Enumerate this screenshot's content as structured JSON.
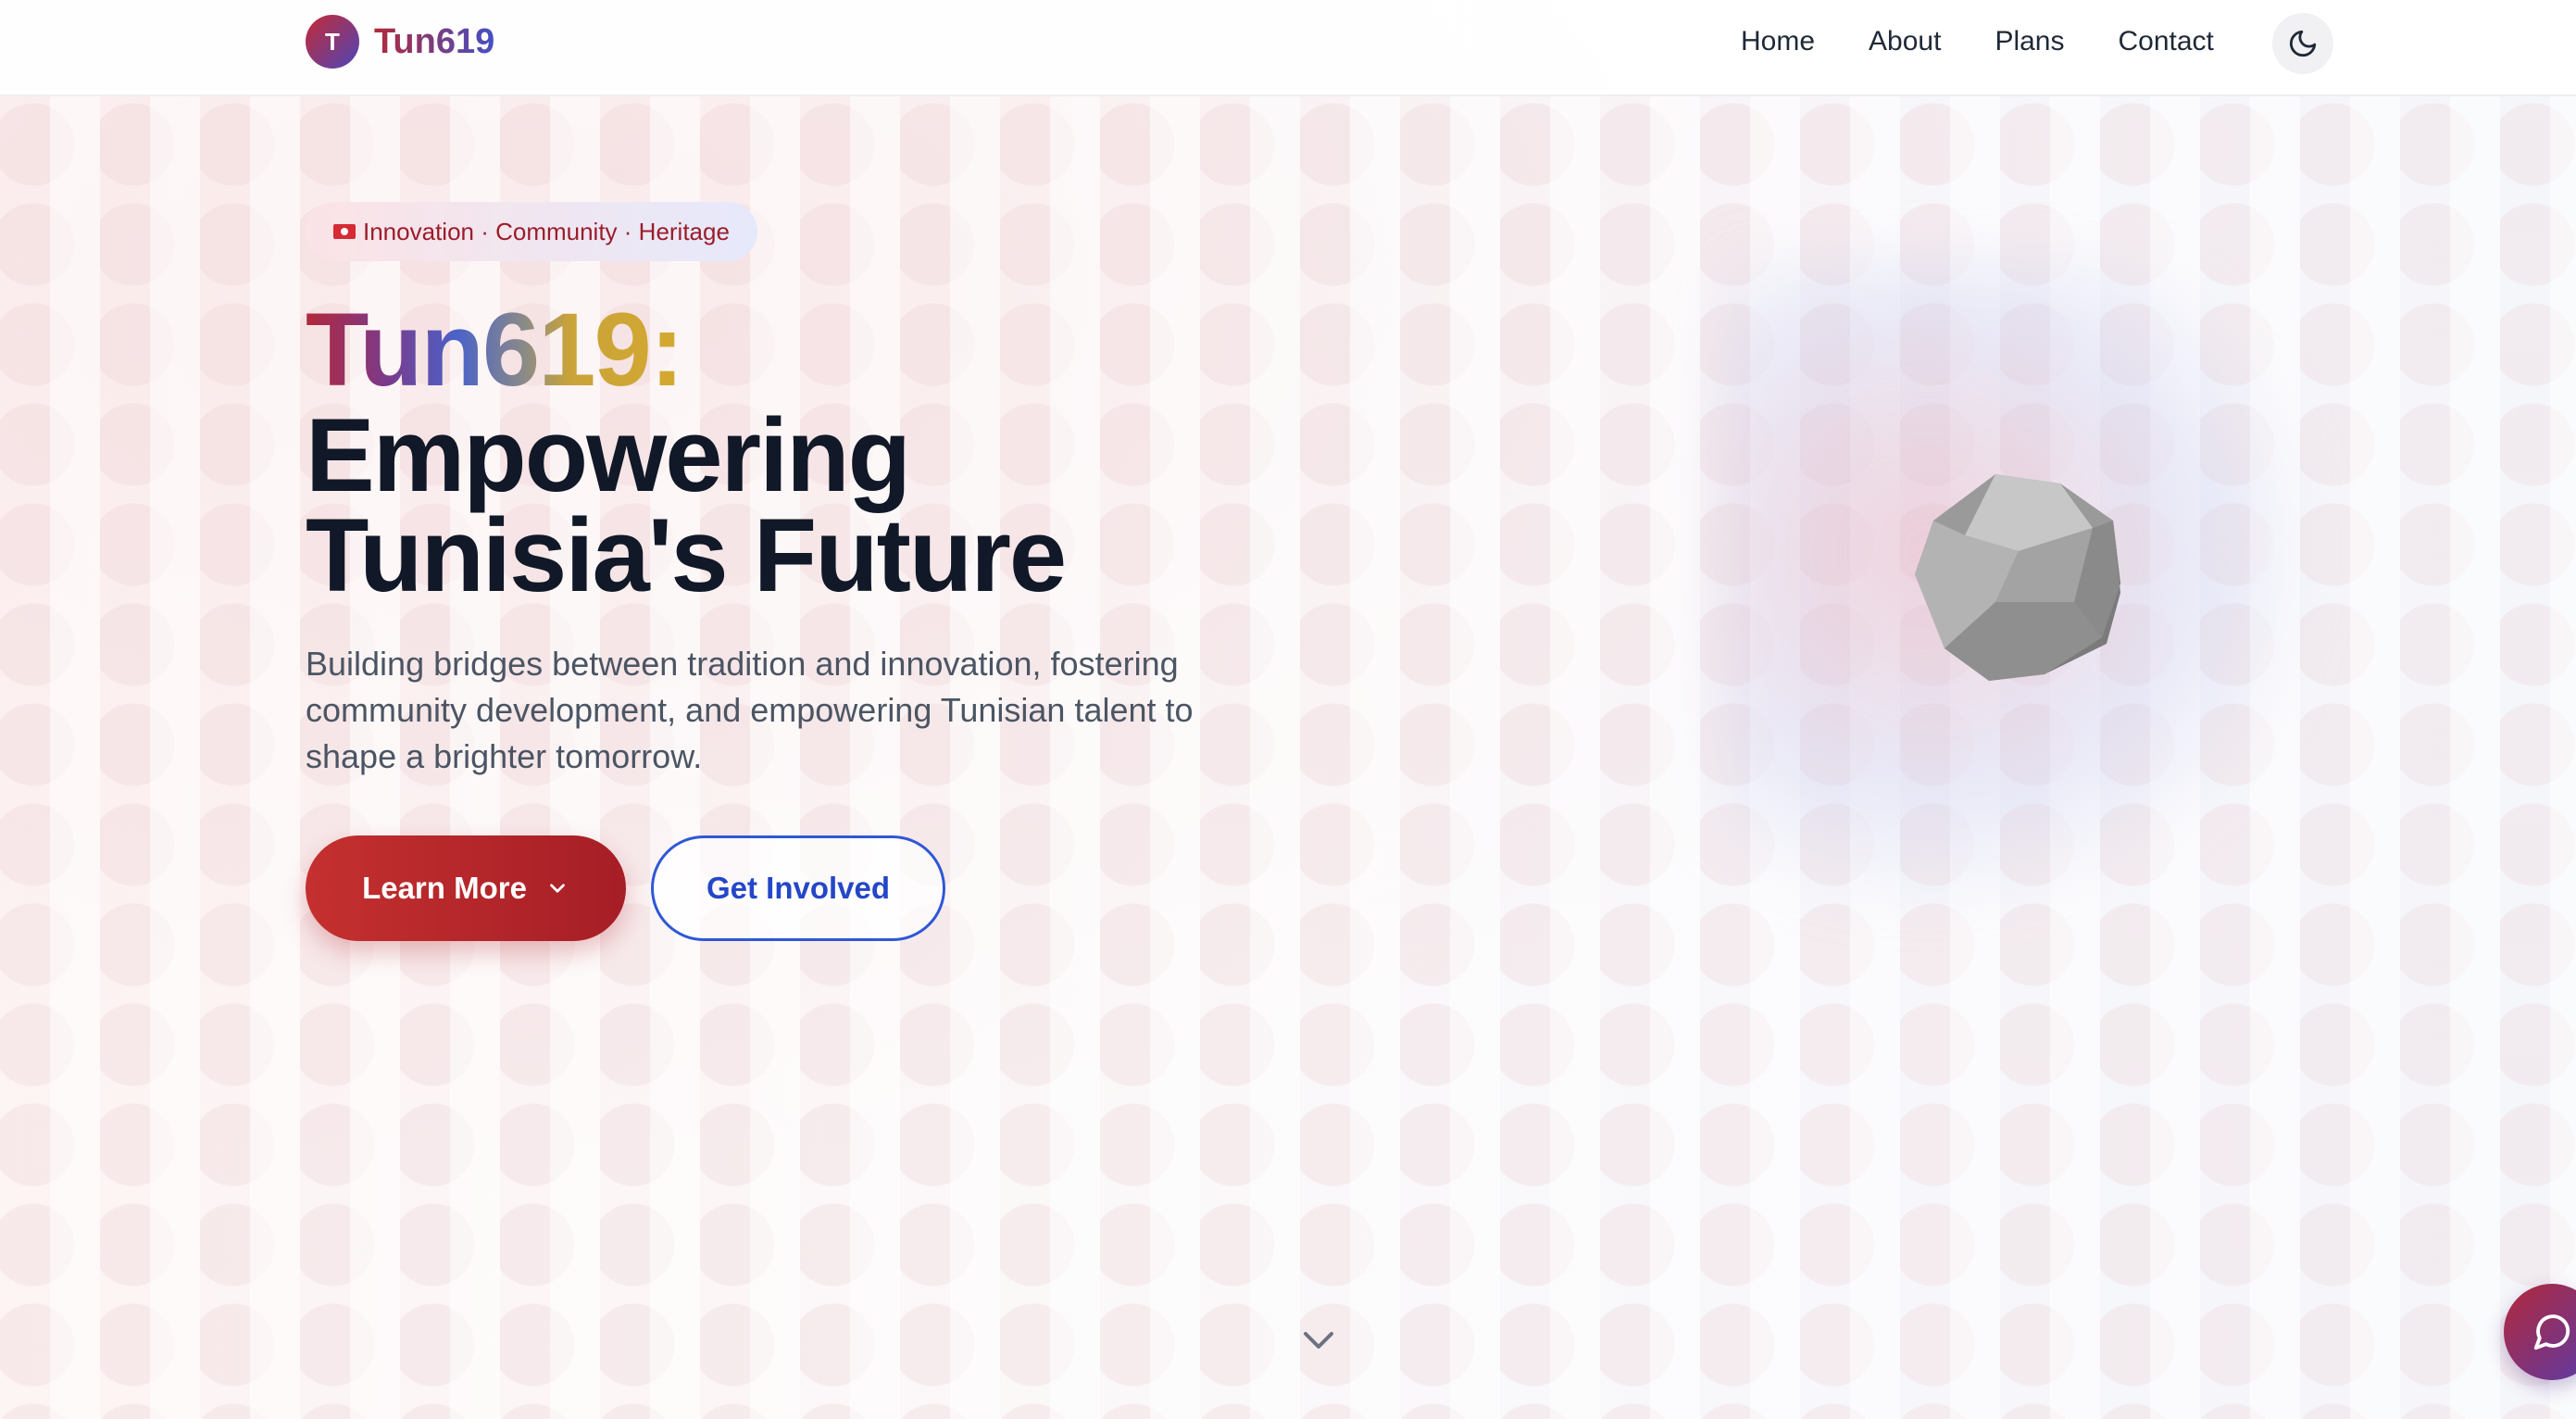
{
  "brand": {
    "logo_initial": "T",
    "name": "Tun619"
  },
  "nav": {
    "items": [
      "Home",
      "About",
      "Plans",
      "Contact"
    ]
  },
  "theme_toggle": {
    "icon": "moon-icon"
  },
  "hero": {
    "badge": "Innovation · Community · Heritage",
    "title_line1": "Tun619:",
    "title_line2": "Empowering",
    "title_line3": "Tunisia's Future",
    "subtitle": "Building bridges between tradition and innovation, fostering community development, and empowering Tunisian talent to shape a brighter tomorrow.",
    "primary_button": "Learn More",
    "secondary_button": "Get Involved"
  },
  "colors": {
    "brand_red": "#c4302f",
    "brand_blue": "#2f57d6",
    "text_dark": "#111827",
    "text_muted": "#4b5563"
  },
  "icons": {
    "scroll": "chevron-down-icon",
    "chat": "chat-bubble-icon",
    "flag": "tunisia-flag-icon"
  }
}
